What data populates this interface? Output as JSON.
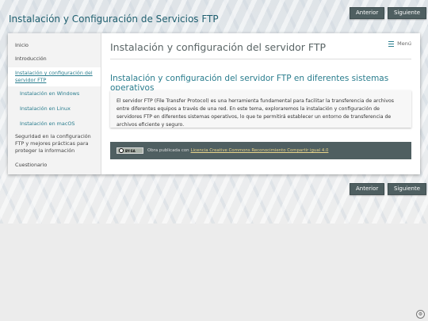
{
  "site": {
    "title": "Instalación y Configuración de Servicios FTP"
  },
  "nav": {
    "prev_label": "Anterior",
    "next_label": "Siguiente"
  },
  "sidebar": {
    "items": [
      {
        "label": "Inicio"
      },
      {
        "label": "Introducción"
      },
      {
        "label": "Instalación y configuración del servidor FTP"
      },
      {
        "label": "Instalación en Windows"
      },
      {
        "label": "Instalación en Linux"
      },
      {
        "label": "Instalación en macOS"
      },
      {
        "label": "Seguridad en la configuración FTP y mejores prácticas para proteger la información"
      },
      {
        "label": "Cuestionario"
      }
    ]
  },
  "main": {
    "page_title": "Instalación y configuración del servidor FTP",
    "menu_label": "Menú",
    "section_title": "Instalación y configuración del servidor FTP en diferentes sistemas operativos",
    "body": "El servidor FTP (File Transfer Protocol) es una herramienta fundamental para facilitar la transferencia de archivos entre diferentes equipos a través de una red. En este tema, exploraremos la instalación y configuración de servidores FTP en diferentes sistemas operativos, lo que te permitirá establecer un entorno de transferencia de archivos eficiente y seguro."
  },
  "license": {
    "badge_text": "BY-SA",
    "prefix": "Obra publicada con",
    "link_text": "Licencia Creative Commons Reconocimiento Compartir igual 4.0"
  },
  "icons": {
    "corner": "accessibility-icon",
    "menu": "hamburger-icon"
  },
  "colors": {
    "accent": "#2a7d8e",
    "title": "#1f5f6f",
    "dark_bar": "#4f5f61"
  }
}
